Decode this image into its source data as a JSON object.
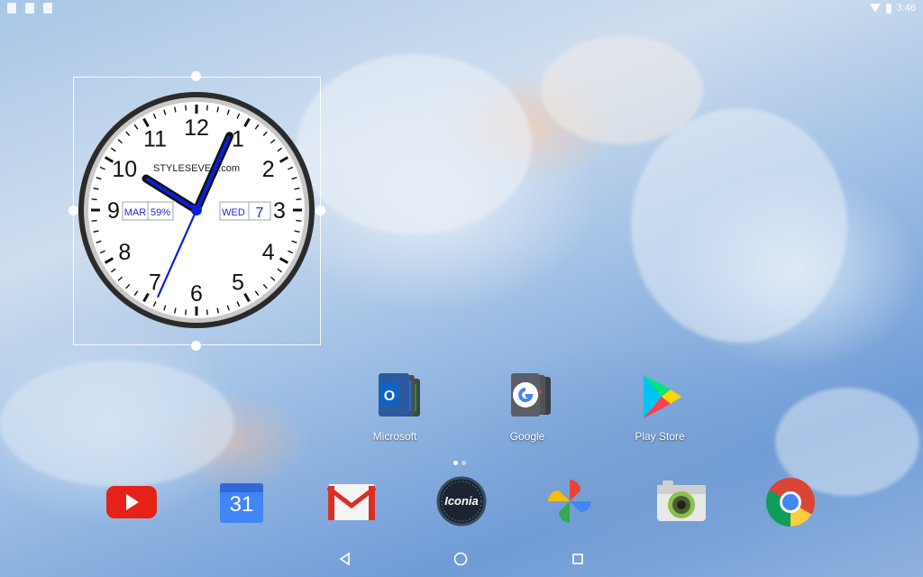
{
  "status_bar": {
    "time": "3:46"
  },
  "clock_widget": {
    "brand": "STYLESEVEN.com",
    "numbers": [
      "12",
      "1",
      "2",
      "3",
      "4",
      "5",
      "6",
      "7",
      "8",
      "9",
      "10",
      "11"
    ],
    "month": "MAR",
    "battery": "59%",
    "weekday": "WED",
    "day": "7",
    "time": {
      "hour": 10,
      "minute": 4,
      "second": 34
    }
  },
  "folders": [
    {
      "label": "Microsoft"
    },
    {
      "label": "Google"
    },
    {
      "label": "Play Store"
    }
  ],
  "dock": {
    "calendar_day": "31",
    "iconia_label": "Iconia",
    "apps": [
      "youtube-icon",
      "calendar-icon",
      "gmail-icon",
      "iconia-icon",
      "photos-icon",
      "camera-icon",
      "chrome-icon"
    ]
  },
  "colors": {
    "hand_blue": "#0a1fd6",
    "accent_blue": "#1a2bd4"
  }
}
